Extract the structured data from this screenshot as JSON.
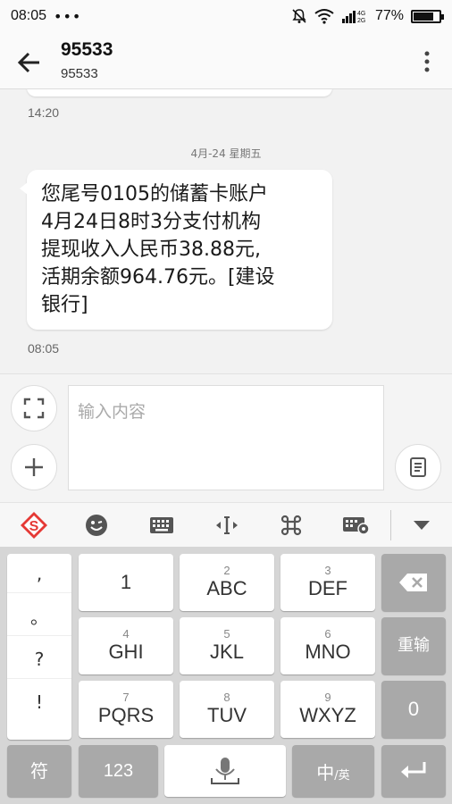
{
  "status_bar": {
    "time": "08:05",
    "dots": "•••",
    "signal_label": "4G 2G",
    "battery_pct": "77%",
    "battery_level": 0.77
  },
  "header": {
    "title": "95533",
    "subtitle": "95533"
  },
  "conversation": {
    "prev_time": "14:20",
    "date_separator": "4月-24  星期五",
    "message_lines": [
      "您尾号0105的储蓄卡账户",
      "4月24日8时3分支付机构",
      "提现收入人民币38.88元,",
      "活期余额964.76元。[建设",
      "银行]"
    ],
    "message_time": "08:05"
  },
  "composer": {
    "placeholder": "输入内容"
  },
  "keyboard": {
    "punct": [
      ",",
      "。",
      "?",
      "!"
    ],
    "rows": [
      [
        {
          "sub": "",
          "main": "1"
        },
        {
          "sub": "2",
          "main": "ABC"
        },
        {
          "sub": "3",
          "main": "DEF"
        }
      ],
      [
        {
          "sub": "4",
          "main": "GHI"
        },
        {
          "sub": "5",
          "main": "JKL"
        },
        {
          "sub": "6",
          "main": "MNO"
        }
      ],
      [
        {
          "sub": "7",
          "main": "PQRS"
        },
        {
          "sub": "8",
          "main": "TUV"
        },
        {
          "sub": "9",
          "main": "WXYZ"
        }
      ]
    ],
    "reenter": "重输",
    "zero": "0",
    "symbols": "符",
    "num": "123",
    "lang_main": "中",
    "lang_sub": "/英"
  },
  "colors": {
    "logo_red": "#e53935",
    "dark_key": "#a9a9a9"
  },
  "icons": [
    "back-arrow-icon",
    "more-vert-icon",
    "fullscreen-icon",
    "plus-icon",
    "note-icon",
    "sogou-logo-icon",
    "emoji-icon",
    "keyboard-icon",
    "cursor-icon",
    "command-icon",
    "keyboard-settings-icon",
    "collapse-icon",
    "backspace-icon",
    "microphone-icon",
    "enter-icon"
  ]
}
